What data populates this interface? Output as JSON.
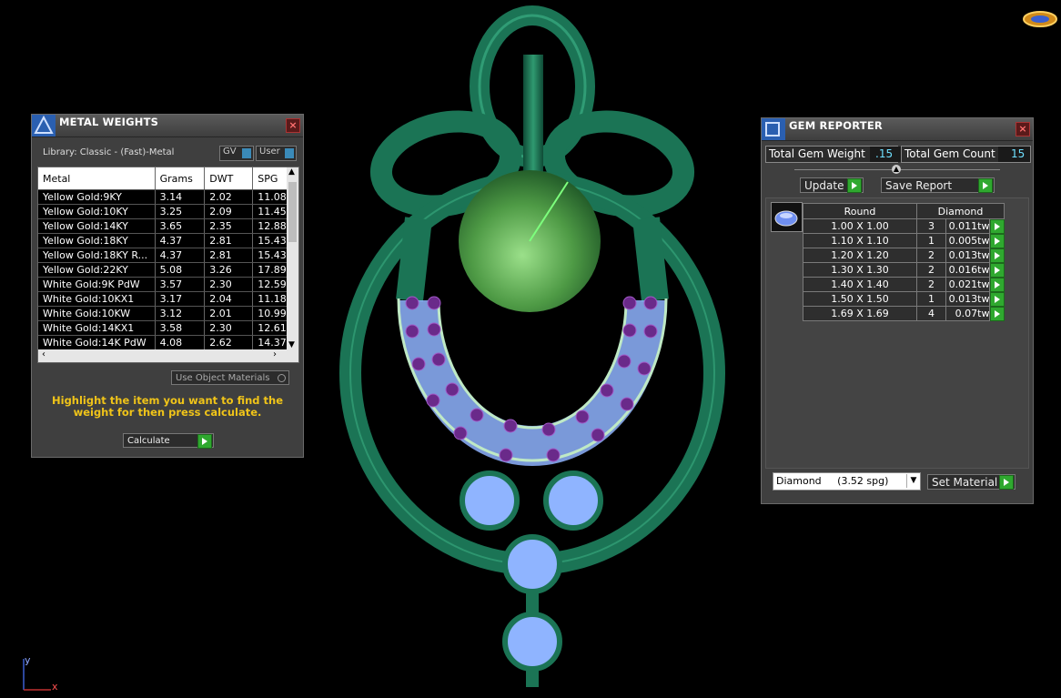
{
  "metal_weights": {
    "title": "METAL WEIGHTS",
    "library": "Library: Classic - (Fast)-Metal",
    "toggle_gv": "GV",
    "toggle_user": "User",
    "columns": [
      "Metal",
      "Grams",
      "DWT",
      "SPG"
    ],
    "rows": [
      [
        "Yellow Gold:9KY",
        "3.14",
        "2.02",
        "11.08"
      ],
      [
        "Yellow Gold:10KY",
        "3.25",
        "2.09",
        "11.45"
      ],
      [
        "Yellow Gold:14KY",
        "3.65",
        "2.35",
        "12.88"
      ],
      [
        "Yellow Gold:18KY",
        "4.37",
        "2.81",
        "15.43"
      ],
      [
        "Yellow Gold:18KY R...",
        "4.37",
        "2.81",
        "15.43"
      ],
      [
        "Yellow Gold:22KY",
        "5.08",
        "3.26",
        "17.89"
      ],
      [
        "White Gold:9K PdW",
        "3.57",
        "2.30",
        "12.59"
      ],
      [
        "White Gold:10KX1",
        "3.17",
        "2.04",
        "11.18"
      ],
      [
        "White Gold:10KW",
        "3.12",
        "2.01",
        "10.99"
      ],
      [
        "White Gold:14KX1",
        "3.58",
        "2.30",
        "12.61"
      ],
      [
        "White Gold:14K PdW",
        "4.08",
        "2.62",
        "14.37"
      ]
    ],
    "use_object_materials": "Use Object Materials",
    "hint": "Highlight the item you want to find the weight for then press calculate.",
    "calculate": "Calculate"
  },
  "gem_reporter": {
    "title": "GEM REPORTER",
    "total_weight_label": "Total Gem Weight",
    "total_weight_value": ".15",
    "total_count_label": "Total Gem Count",
    "total_count_value": "15",
    "update": "Update",
    "save_report": "Save Report",
    "col_shape": "Round",
    "col_material": "Diamond",
    "rows": [
      [
        "1.00 X 1.00",
        "3",
        "0.011tw"
      ],
      [
        "1.10 X 1.10",
        "1",
        "0.005tw"
      ],
      [
        "1.20 X 1.20",
        "2",
        "0.013tw"
      ],
      [
        "1.30 X 1.30",
        "2",
        "0.016tw"
      ],
      [
        "1.40 X 1.40",
        "2",
        "0.021tw"
      ],
      [
        "1.50 X 1.50",
        "1",
        "0.013tw"
      ],
      [
        "1.69 X 1.69",
        "4",
        "0.07tw"
      ]
    ],
    "material_select": "Diamond     (3.52 spg)",
    "set_material": "Set Material"
  },
  "axis": {
    "y": "y",
    "x": "x"
  },
  "colors": {
    "panel_bg": "#3f3f3f",
    "accent_yellow": "#f0c419",
    "button_green": "#2fa82f",
    "model_green": "#1e7a5a",
    "gem_blue": "#8fb4ff",
    "gem_purple": "#6a2a8a"
  }
}
